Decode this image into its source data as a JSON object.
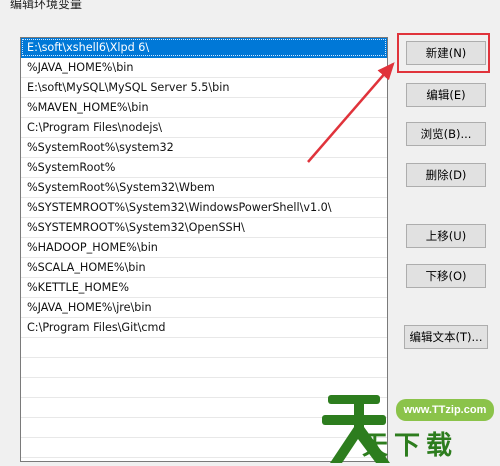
{
  "dialog": {
    "title": "编辑环境变量"
  },
  "path_list": {
    "items": [
      "E:\\soft\\xshell6\\Xlpd 6\\",
      "%JAVA_HOME%\\bin",
      "E:\\soft\\MySQL\\MySQL Server 5.5\\bin",
      "%MAVEN_HOME%\\bin",
      "C:\\Program Files\\nodejs\\",
      "%SystemRoot%\\system32",
      "%SystemRoot%",
      "%SystemRoot%\\System32\\Wbem",
      "%SYSTEMROOT%\\System32\\WindowsPowerShell\\v1.0\\",
      "%SYSTEMROOT%\\System32\\OpenSSH\\",
      "%HADOOP_HOME%\\bin",
      "%SCALA_HOME%\\bin",
      "%KETTLE_HOME%",
      "%JAVA_HOME%\\jre\\bin",
      "C:\\Program Files\\Git\\cmd",
      "",
      "",
      "",
      "",
      "",
      ""
    ],
    "selected_index": 0
  },
  "buttons": {
    "new": "新建(N)",
    "edit": "编辑(E)",
    "browse": "浏览(B)...",
    "delete": "删除(D)",
    "move_up": "上移(U)",
    "move_down": "下移(O)",
    "edit_text": "编辑文本(T)..."
  },
  "watermark": {
    "url": "www.TTzip.com",
    "text": "天下载"
  },
  "colors": {
    "selection": "#0078d7",
    "annotation": "#e0333b",
    "watermark_green": "#2d7d1e"
  }
}
